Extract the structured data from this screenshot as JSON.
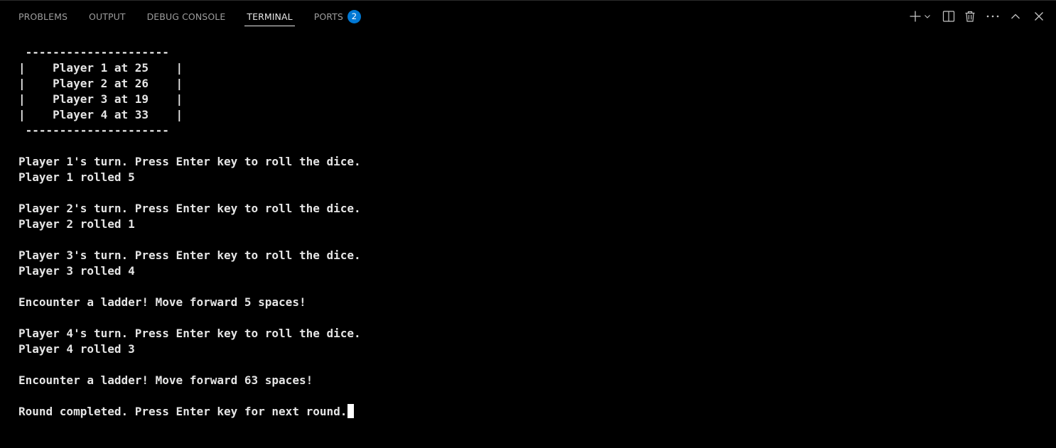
{
  "tabs": [
    {
      "label": "PROBLEMS"
    },
    {
      "label": "OUTPUT"
    },
    {
      "label": "DEBUG CONSOLE"
    },
    {
      "label": "TERMINAL"
    },
    {
      "label": "PORTS",
      "badge": "2"
    }
  ],
  "actions": [
    "plus-icon",
    "chevron-down-icon",
    "split-terminal-icon",
    "trash-icon",
    "more-icon",
    "maximize-panel-icon",
    "close-icon"
  ],
  "terminal": {
    "lines": [
      " ---------------------",
      "|    Player 1 at 25    |",
      "|    Player 2 at 26    |",
      "|    Player 3 at 19    |",
      "|    Player 4 at 33    |",
      " ---------------------",
      "",
      "Player 1's turn. Press Enter key to roll the dice.",
      "Player 1 rolled 5",
      "",
      "Player 2's turn. Press Enter key to roll the dice.",
      "Player 2 rolled 1",
      "",
      "Player 3's turn. Press Enter key to roll the dice.",
      "Player 3 rolled 4",
      "",
      "Encounter a ladder! Move forward 5 spaces!",
      "",
      "Player 4's turn. Press Enter key to roll the dice.",
      "Player 4 rolled 3",
      "",
      "Encounter a ladder! Move forward 63 spaces!",
      "",
      "Round completed. Press Enter key for next round."
    ]
  },
  "colors": {
    "background": "#000000",
    "text": "#e5e5e5",
    "tab_inactive": "#9d9d9d",
    "tab_active": "#e7e7e7",
    "badge": "#0078d4"
  }
}
